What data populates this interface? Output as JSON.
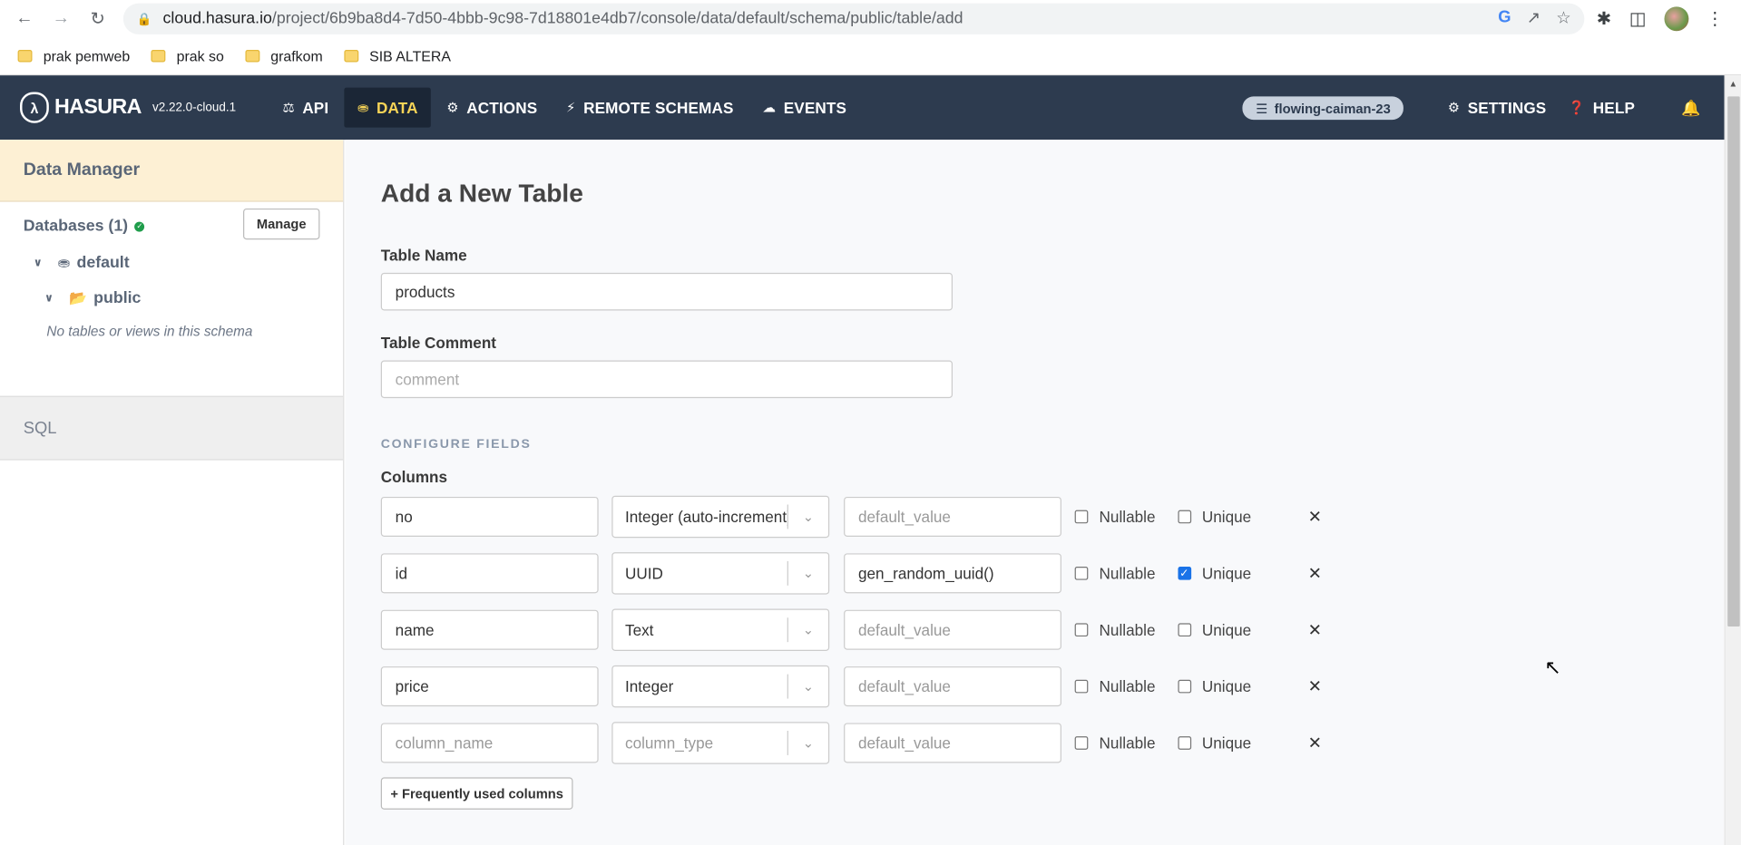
{
  "browser": {
    "url_host": "cloud.hasura.io",
    "url_path": "/project/6b9ba8d4-7d50-4bbb-9c98-7d18801e4db7/console/data/default/schema/public/table/add",
    "bookmarks": [
      "prak pemweb",
      "prak so",
      "grafkom",
      "SIB ALTERA"
    ]
  },
  "header": {
    "brand": "HASURA",
    "version": "v2.22.0-cloud.1",
    "nav": [
      {
        "label": "API",
        "icon": "flask-icon"
      },
      {
        "label": "DATA",
        "icon": "database-icon"
      },
      {
        "label": "ACTIONS",
        "icon": "gears-icon"
      },
      {
        "label": "REMOTE SCHEMAS",
        "icon": "plug-icon"
      },
      {
        "label": "EVENTS",
        "icon": "cloud-icon"
      }
    ],
    "project": "flowing-caiman-23",
    "settings_label": "SETTINGS",
    "help_label": "HELP"
  },
  "sidebar": {
    "title": "Data Manager",
    "databases_label": "Databases (1)",
    "manage_label": "Manage",
    "db_name": "default",
    "schema_name": "public",
    "empty_note": "No tables or views in this schema",
    "sql_label": "SQL"
  },
  "form": {
    "title": "Add a New Table",
    "table_name_label": "Table Name",
    "table_name_value": "products",
    "table_comment_label": "Table Comment",
    "table_comment_placeholder": "comment",
    "configure_caption": "CONFIGURE FIELDS",
    "columns_label": "Columns",
    "nullable_label": "Nullable",
    "unique_label": "Unique",
    "frequent_btn": "+ Frequently used columns",
    "name_placeholder": "column_name",
    "type_placeholder": "column_type",
    "default_placeholder": "default_value",
    "columns": [
      {
        "name": "no",
        "type": "Integer (auto-increment)",
        "default": "",
        "nullable": false,
        "unique": false
      },
      {
        "name": "id",
        "type": "UUID",
        "default": "gen_random_uuid()",
        "nullable": false,
        "unique": true
      },
      {
        "name": "name",
        "type": "Text",
        "default": "",
        "nullable": false,
        "unique": false
      },
      {
        "name": "price",
        "type": "Integer",
        "default": "",
        "nullable": false,
        "unique": false
      },
      {
        "name": "",
        "type": "",
        "default": "",
        "nullable": false,
        "unique": false
      }
    ]
  },
  "colors": {
    "header_bg": "#2d3b4f",
    "active_nav_text": "#f8d457",
    "sidebar_head_bg": "#fdf0d4",
    "connected": "#1f9d4b"
  }
}
